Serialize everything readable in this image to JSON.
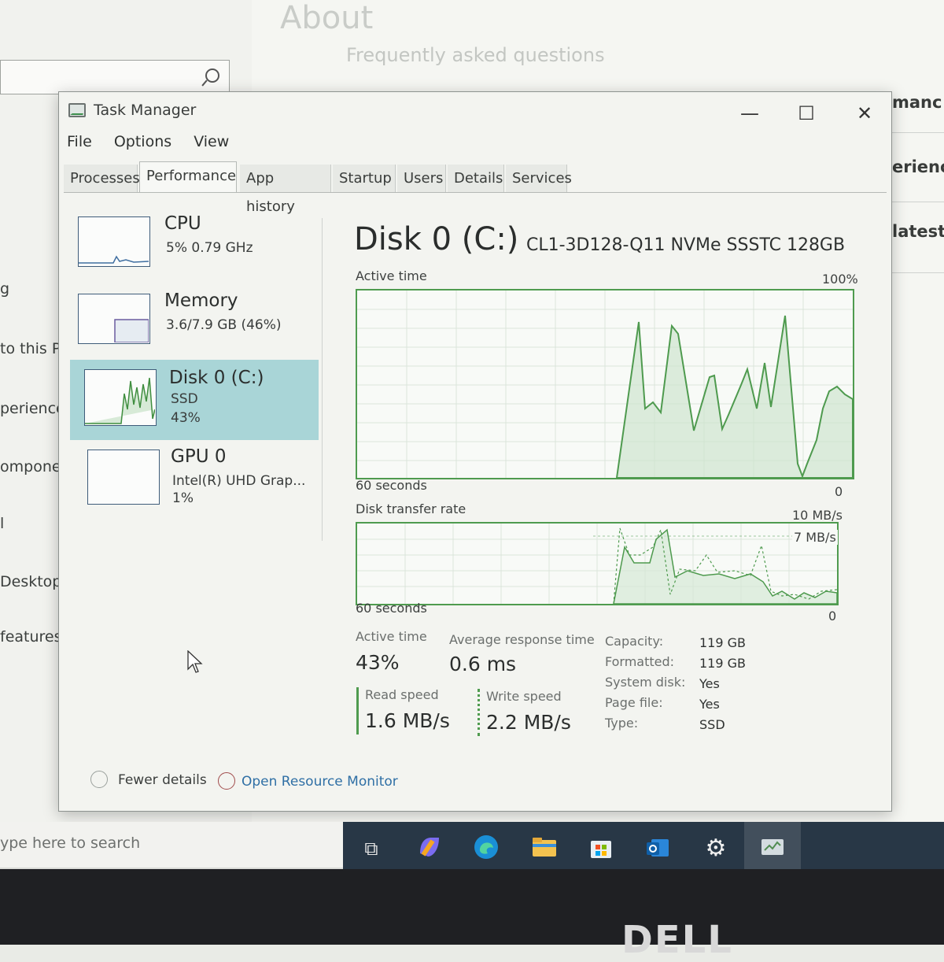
{
  "background": {
    "about_title": "About",
    "faq": "Frequently asked questions",
    "nav": [
      "g",
      "to this P",
      "periences",
      "omponen",
      "l",
      "Desktop",
      " features"
    ],
    "right_snippets": [
      "manc",
      "erienc",
      "latest"
    ]
  },
  "window": {
    "title": "Task Manager",
    "controls": {
      "minimize": "—",
      "maximize": "☐",
      "close": "✕"
    },
    "menu": [
      "File",
      "Options",
      "View"
    ],
    "tabs": [
      "Processes",
      "Performance",
      "App history",
      "Startup",
      "Users",
      "Details",
      "Services"
    ],
    "active_tab": "Performance"
  },
  "resources": [
    {
      "name": "CPU",
      "line1": "5% 0.79 GHz",
      "line2": ""
    },
    {
      "name": "Memory",
      "line1": "3.6/7.9 GB (46%)",
      "line2": ""
    },
    {
      "name": "Disk 0 (C:)",
      "line1": "SSD",
      "line2": "43%"
    },
    {
      "name": "GPU 0",
      "line1": "Intel(R) UHD Grap...",
      "line2": "1%"
    }
  ],
  "details": {
    "title": "Disk 0 (C:)",
    "model": "CL1-3D128-Q11 NVMe SSSTC 128GB",
    "graph1": {
      "label": "Active time",
      "max": "100%",
      "time": "60 seconds",
      "min": "0"
    },
    "graph2": {
      "label": "Disk transfer rate",
      "max": "10 MB/s",
      "mid": "7 MB/s",
      "time": "60 seconds",
      "min": "0"
    },
    "stats": {
      "active_time_label": "Active time",
      "active_time": "43%",
      "avg_resp_label": "Average response time",
      "avg_resp": "0.6 ms",
      "read_label": "Read speed",
      "read": "1.6 MB/s",
      "write_label": "Write speed",
      "write": "2.2 MB/s"
    },
    "properties": [
      {
        "label": "Capacity:",
        "value": "119 GB"
      },
      {
        "label": "Formatted:",
        "value": "119 GB"
      },
      {
        "label": "System disk:",
        "value": "Yes"
      },
      {
        "label": "Page file:",
        "value": "Yes"
      },
      {
        "label": "Type:",
        "value": "SSD"
      }
    ]
  },
  "footer": {
    "fewer": "Fewer details",
    "monitor": "Open Resource Monitor"
  },
  "taskbar": {
    "search_placeholder": "ype here to search",
    "icons": [
      "task-view",
      "copilot",
      "edge",
      "file-explorer",
      "store",
      "outlook",
      "settings",
      "task-manager"
    ]
  },
  "logo": "DELL"
}
